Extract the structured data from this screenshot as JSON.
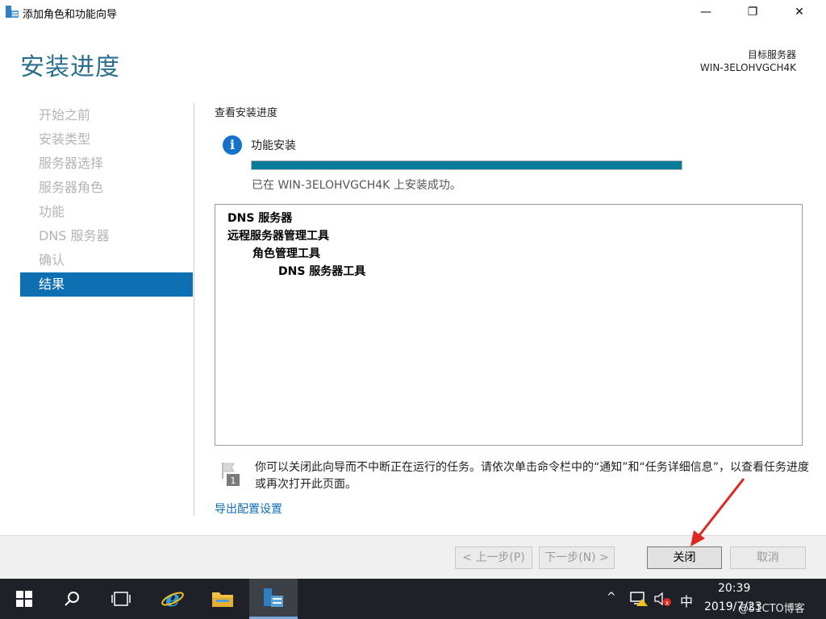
{
  "window": {
    "title": "添加角色和功能向导",
    "minimize_label": "—",
    "maximize_label": "❐",
    "close_label": "✕"
  },
  "header": {
    "page_title": "安装进度",
    "target_label": "目标服务器",
    "target_server": "WIN-3ELOHVGCH4K"
  },
  "nav": {
    "items": [
      {
        "label": "开始之前"
      },
      {
        "label": "安装类型"
      },
      {
        "label": "服务器选择"
      },
      {
        "label": "服务器角色"
      },
      {
        "label": "功能"
      },
      {
        "label": "DNS 服务器"
      },
      {
        "label": "确认"
      },
      {
        "label": "结果"
      }
    ],
    "active_index": 7
  },
  "main": {
    "section_label": "查看安装进度",
    "feature_label": "功能安装",
    "progress_fraction": 1.0,
    "success_text": "已在 WIN-3ELOHVGCH4K 上安装成功。",
    "results": [
      {
        "label": "DNS 服务器",
        "level": 1
      },
      {
        "label": "远程服务器管理工具",
        "level": 1
      },
      {
        "label": "角色管理工具",
        "level": 2
      },
      {
        "label": "DNS 服务器工具",
        "level": 3
      }
    ],
    "notice": "你可以关闭此向导而不中断正在运行的任务。请依次单击命令栏中的“通知”和“任务详细信息”，以查看任务进度或再次打开此页面。",
    "export_link": "导出配置设置"
  },
  "buttons": {
    "prev": "< 上一步(P)",
    "next": "下一步(N) >",
    "close": "关闭",
    "cancel": "取消"
  },
  "taskbar": {
    "clock_time": "20:39",
    "clock_date": "2019/7/23",
    "ime": "中",
    "watermark": "@51CTO博客"
  },
  "colors": {
    "accent": "#0e70b2",
    "heading": "#2b6f8f",
    "progress": "#097c9b",
    "arrow": "#e0271f"
  }
}
